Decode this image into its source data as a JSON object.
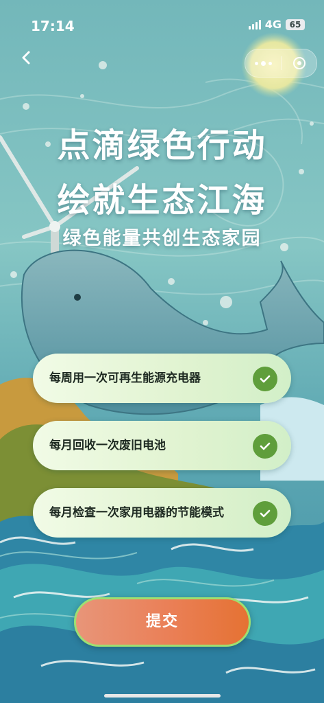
{
  "status_bar": {
    "time": "17:14",
    "network": "4G",
    "battery": "65"
  },
  "nav": {
    "back_icon": "chevron-left-icon",
    "more_icon": "more-dots-icon",
    "close_icon": "target-close-icon"
  },
  "hero": {
    "title_line1": "点滴绿色行动",
    "title_line2": "绘就生态江海",
    "subtitle": "绿色能量共创生态家园"
  },
  "tasks": [
    {
      "label": "每周用一次可再生能源充电器",
      "checked": true
    },
    {
      "label": "每月回收一次废旧电池",
      "checked": true
    },
    {
      "label": "每月检查一次家用电器的节能模式",
      "checked": true
    }
  ],
  "submit_label": "提交",
  "colors": {
    "check": "#5f9e3b",
    "submit_start": "#e89579",
    "submit_end": "#e57233",
    "submit_border": "#9de072",
    "sky": "#7fc0c2"
  }
}
